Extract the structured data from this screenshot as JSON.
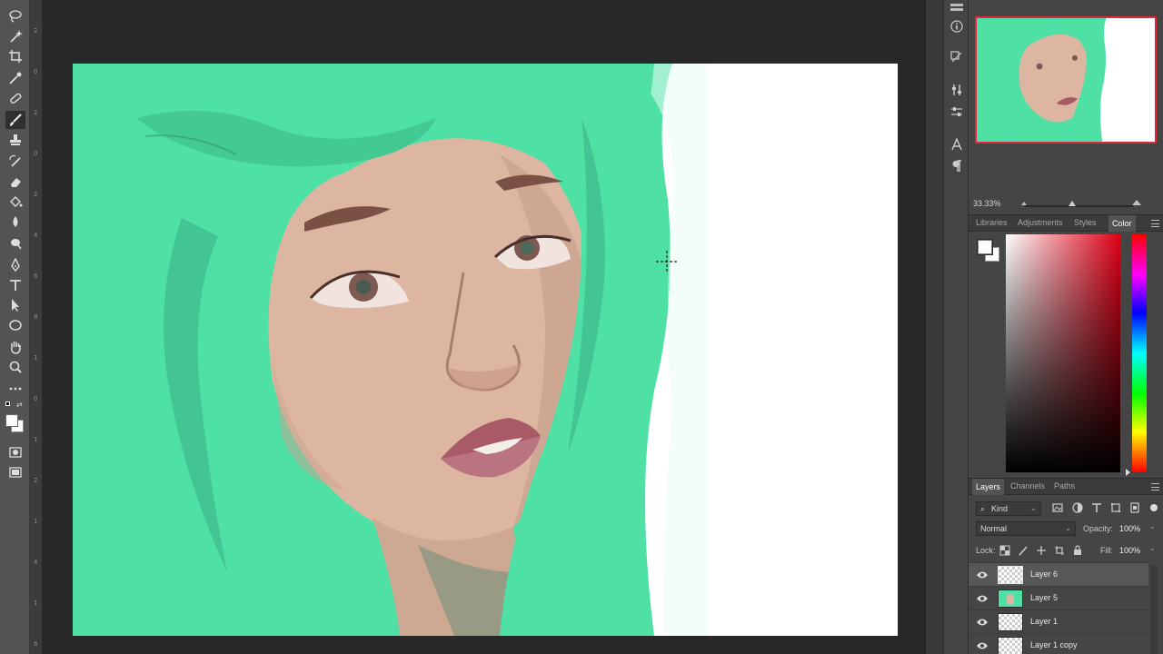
{
  "toolbar": {
    "tools": [
      "lasso-tool-icon",
      "magic-wand-icon",
      "crop-icon",
      "eyedropper-icon",
      "healing-brush-icon",
      "brush-icon",
      "clone-stamp-icon",
      "history-brush-icon",
      "eraser-icon",
      "paint-bucket-icon",
      "blur-icon",
      "dodge-icon",
      "pen-icon",
      "type-icon",
      "path-select-icon",
      "ellipse-icon",
      "hand-icon",
      "zoom-icon",
      "more-tools-icon"
    ],
    "active_tool": "brush-icon"
  },
  "ruler": {
    "ticks": [
      "2",
      "0",
      "2",
      "0",
      "2",
      "4",
      "6",
      "8",
      "1",
      "0",
      "1",
      "2",
      "1",
      "4",
      "1",
      "6"
    ]
  },
  "navigator": {
    "zoom": "33.33%"
  },
  "color_panel": {
    "tabs": [
      "Libraries",
      "Adjustments",
      "Styles",
      "Color"
    ],
    "active_tab": "Color",
    "hue_color": "#e00016"
  },
  "layers_panel": {
    "tabs": [
      "Layers",
      "Channels",
      "Paths"
    ],
    "active_tab": "Layers",
    "filter_kind": "Kind",
    "blend_mode": "Normal",
    "opacity_label": "Opacity:",
    "opacity": "100%",
    "lock_label": "Lock:",
    "fill_label": "Fill:",
    "fill": "100%",
    "layers": [
      {
        "name": "Layer 6",
        "selected": true
      },
      {
        "name": "Layer 5",
        "selected": false
      },
      {
        "name": "Layer 1",
        "selected": false
      },
      {
        "name": "Layer 1 copy",
        "selected": false
      }
    ]
  },
  "colors": {
    "hair": "#4fe0a6",
    "skin": "#dcb6a0",
    "accent_red": "#e02a3c"
  }
}
